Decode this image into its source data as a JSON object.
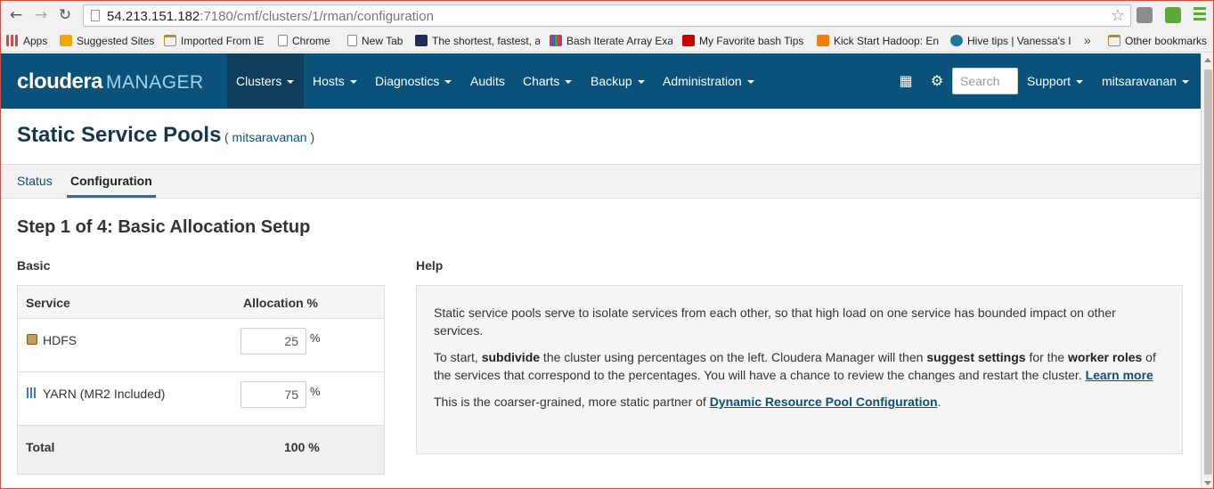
{
  "browser": {
    "url_host": "54.213.151.182",
    "url_path": ":7180/cmf/clusters/1/rman/configuration",
    "back_icon": "arrow-left-icon",
    "forward_icon": "arrow-right-icon",
    "reload_icon": "reload-icon"
  },
  "bookmarks": [
    {
      "label": "Apps"
    },
    {
      "label": "Suggested Sites"
    },
    {
      "label": "Imported From IE"
    },
    {
      "label": "Chrome"
    },
    {
      "label": "New Tab"
    },
    {
      "label": "The shortest, fastest, a"
    },
    {
      "label": "Bash Iterate Array Exa"
    },
    {
      "label": "My Favorite bash Tips"
    },
    {
      "label": "Kick Start Hadoop: En"
    },
    {
      "label": "Hive tips | Vanessa's I"
    },
    {
      "label": "Other bookmarks"
    }
  ],
  "header": {
    "logo_main": "cloudera",
    "logo_sub": "MANAGER",
    "nav": [
      {
        "label": "Clusters"
      },
      {
        "label": "Hosts"
      },
      {
        "label": "Diagnostics"
      },
      {
        "label": "Audits"
      },
      {
        "label": "Charts"
      },
      {
        "label": "Backup"
      },
      {
        "label": "Administration"
      }
    ],
    "search_placeholder": "Search",
    "support_label": "Support",
    "user_label": "mitsaravanan"
  },
  "page": {
    "title": "Static Service Pools",
    "subtitle": "( mitsaravanan )",
    "tabs": [
      {
        "label": "Status"
      },
      {
        "label": "Configuration"
      }
    ],
    "step_title": "Step 1 of 4: Basic Allocation Setup",
    "basic_label": "Basic",
    "help_label": "Help"
  },
  "allocation": {
    "col_service": "Service",
    "col_allocation": "Allocation %",
    "rows": [
      {
        "service": "HDFS",
        "value": "25",
        "unit": "%"
      },
      {
        "service": "YARN (MR2 Included)",
        "value": "75",
        "unit": "%"
      }
    ],
    "total_label": "Total",
    "total_value": "100 %"
  },
  "help": {
    "p1": "Static service pools serve to isolate services from each other, so that high load on one service has bounded impact on other services.",
    "p2_a": "To start, ",
    "p2_b": "subdivide",
    "p2_c": " the cluster using percentages on the left. Cloudera Manager will then ",
    "p2_d": "suggest settings",
    "p2_e": " for the ",
    "p2_f": "worker roles",
    "p2_g": " of the services that correspond to the percentages. You will have a chance to review the changes and restart the cluster. ",
    "p2_link": "Learn more",
    "p3_a": "This is the coarser-grained, more static partner of ",
    "p3_link": "Dynamic Resource Pool Configuration",
    "p3_b": "."
  },
  "colors": {
    "header_bg": "#0a5279",
    "header_active": "#0f3d5c",
    "link": "#0a5279"
  }
}
